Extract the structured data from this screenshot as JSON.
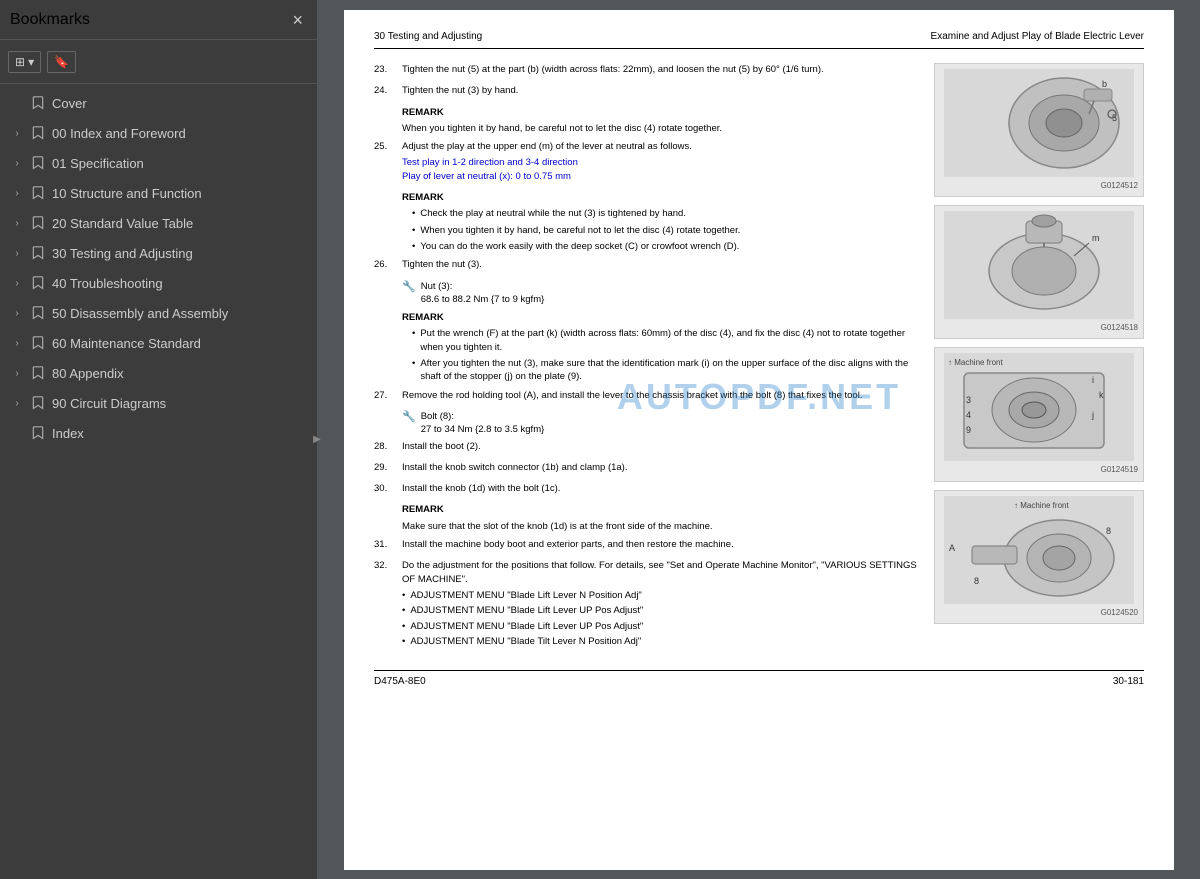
{
  "sidebar": {
    "title": "Bookmarks",
    "close_label": "×",
    "toolbar": {
      "view_btn": "☰",
      "bookmark_btn": "🔖"
    },
    "items": [
      {
        "id": "cover",
        "label": "Cover",
        "expandable": false
      },
      {
        "id": "00-index",
        "label": "00 Index and Foreword",
        "expandable": true
      },
      {
        "id": "01-spec",
        "label": "01 Specification",
        "expandable": true
      },
      {
        "id": "10-structure",
        "label": "10 Structure and Function",
        "expandable": true
      },
      {
        "id": "20-standard",
        "label": "20 Standard Value Table",
        "expandable": true
      },
      {
        "id": "30-testing",
        "label": "30 Testing and Adjusting",
        "expandable": true
      },
      {
        "id": "40-trouble",
        "label": "40 Troubleshooting",
        "expandable": true
      },
      {
        "id": "50-disassembly",
        "label": "50 Disassembly and Assembly",
        "expandable": true
      },
      {
        "id": "60-maintenance",
        "label": "60 Maintenance Standard",
        "expandable": true
      },
      {
        "id": "80-appendix",
        "label": "80 Appendix",
        "expandable": true
      },
      {
        "id": "90-circuit",
        "label": "90 Circuit Diagrams",
        "expandable": true
      },
      {
        "id": "index",
        "label": "Index",
        "expandable": false
      }
    ]
  },
  "pdf": {
    "header_left": "30 Testing and Adjusting",
    "header_right": "Examine and Adjust Play of Blade Electric Lever",
    "steps": [
      {
        "num": "23.",
        "text": "Tighten the nut (5) at the part (b) (width across flats: 22mm), and loosen the nut (5) by 60° (1/6 turn)."
      },
      {
        "num": "24.",
        "text": "Tighten the nut (3) by hand."
      }
    ],
    "remark1": {
      "title": "REMARK",
      "text": "When you tighten it by hand, be careful not to let the disc (4) rotate together."
    },
    "step25": {
      "num": "25.",
      "text": "Adjust the play at the upper end (m) of the lever at neutral as follows."
    },
    "blue_lines": [
      "Test play in 1-2 direction and 3-4 direction",
      "Play of lever at neutral (x): 0 to 0.75 mm"
    ],
    "remark2": {
      "title": "REMARK",
      "bullets": [
        "Check the play at neutral while the nut (3) is tightened by hand.",
        "When you tighten it by hand, be careful not to let the disc (4) rotate together.",
        "You can do the work easily with the deep socket (C) or crowfoot wrench (D)."
      ]
    },
    "step26": {
      "num": "26.",
      "text": "Tighten the nut (3)."
    },
    "torque_nut3": {
      "label": "Nut (3):",
      "value": "68.6 to 88.2 Nm {7 to 9 kgfm}"
    },
    "remark3": {
      "title": "REMARK",
      "bullets": [
        "Put the wrench (F) at the part (k) (width across flats: 60mm) of the disc (4), and fix the disc (4) not to rotate together when you tighten it.",
        "After you tighten the nut (3), make sure that the identification mark (i) on the upper surface of the disc aligns with the shaft of the stopper (j) on the plate (9)."
      ]
    },
    "step27": {
      "num": "27.",
      "text": "Remove the rod holding tool (A), and install the lever to the chassis bracket with the bolt (8) that fixes the tool."
    },
    "torque_bolt8": {
      "label": "Bolt (8):",
      "value": "27 to 34 Nm {2.8 to 3.5 kgfm}"
    },
    "step28": {
      "num": "28.",
      "text": "Install the boot (2)."
    },
    "step29": {
      "num": "29.",
      "text": "Install the knob switch connector (1b) and clamp (1a)."
    },
    "step30": {
      "num": "30.",
      "text": "Install the knob (1d) with the bolt (1c)."
    },
    "remark4": {
      "title": "REMARK",
      "text": "Make sure that the slot of the knob (1d) is at the front side of the machine."
    },
    "step31": {
      "num": "31.",
      "text": "Install the machine body boot and exterior parts, and then restore the machine."
    },
    "step32": {
      "num": "32.",
      "text": "Do the adjustment for the positions that follow. For details, see \"Set and Operate Machine Monitor\", \"VARIOUS SETTINGS OF MACHINE\"."
    },
    "adj_menus": [
      "ADJUSTMENT MENU \"Blade Lift Lever N Position Adj\"",
      "ADJUSTMENT MENU \"Blade Lift Lever UP Pos Adjust\"",
      "ADJUSTMENT MENU \"Blade Lift Lever UP Pos Adjust\"",
      "ADJUSTMENT MENU \"Blade Tilt Lever N Position Adj\""
    ],
    "footer_left": "D475A-8E0",
    "footer_right": "30-181",
    "images": [
      {
        "id": "G0124512",
        "label": "G0124512"
      },
      {
        "id": "G0124518",
        "label": "G0124518"
      },
      {
        "id": "G0124519",
        "label": "G0124519"
      },
      {
        "id": "G0124520",
        "label": "G0124520"
      }
    ],
    "watermark": "AUTOPDF.NET"
  }
}
